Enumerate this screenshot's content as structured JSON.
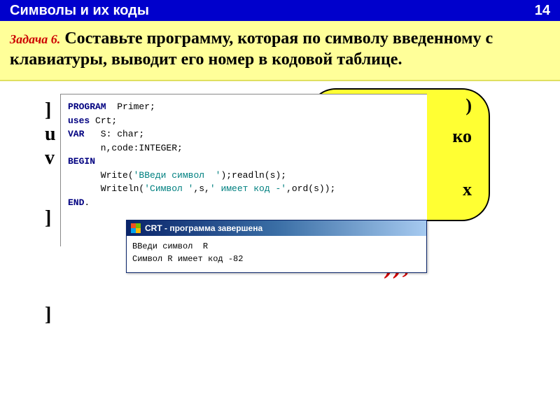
{
  "header": {
    "title": "Символы  и их коды",
    "page_num": "14"
  },
  "task": {
    "label": "Задача 6.",
    "text": "Составьте программу, которая по символу введенному с клавиатуры, выводит его номер в кодовой таблице."
  },
  "bg_yellow": {
    "l1": ")",
    "l2": "ко",
    "l3": "х"
  },
  "left_brackets": {
    "b1": "]",
    "b2": "u",
    "b3": "v",
    "b4": "]",
    "b5": "]"
  },
  "red_frag": "));",
  "code": {
    "l1a": "PROGRAM",
    "l1b": "  Primer;",
    "l2a": "uses",
    "l2b": " Crt;",
    "l3a": "VAR",
    "l3b": "   S: char;",
    "l4": "      n,code:INTEGER;",
    "l5a": "BEGIN",
    "l6a": "      Write(",
    "l6s": "'ВВеди символ  '",
    "l6b": ");readln(s);",
    "l7a": "      Writeln(",
    "l7s1": "'Символ '",
    "l7b": ",s,",
    "l7s2": "' имеет код -'",
    "l7c": ",ord(s));",
    "l8a": "END",
    "l8b": "."
  },
  "console": {
    "title": "CRT - программа завершена",
    "out1": "ВВеди символ  R",
    "out2": "Символ R имеет код -82"
  }
}
